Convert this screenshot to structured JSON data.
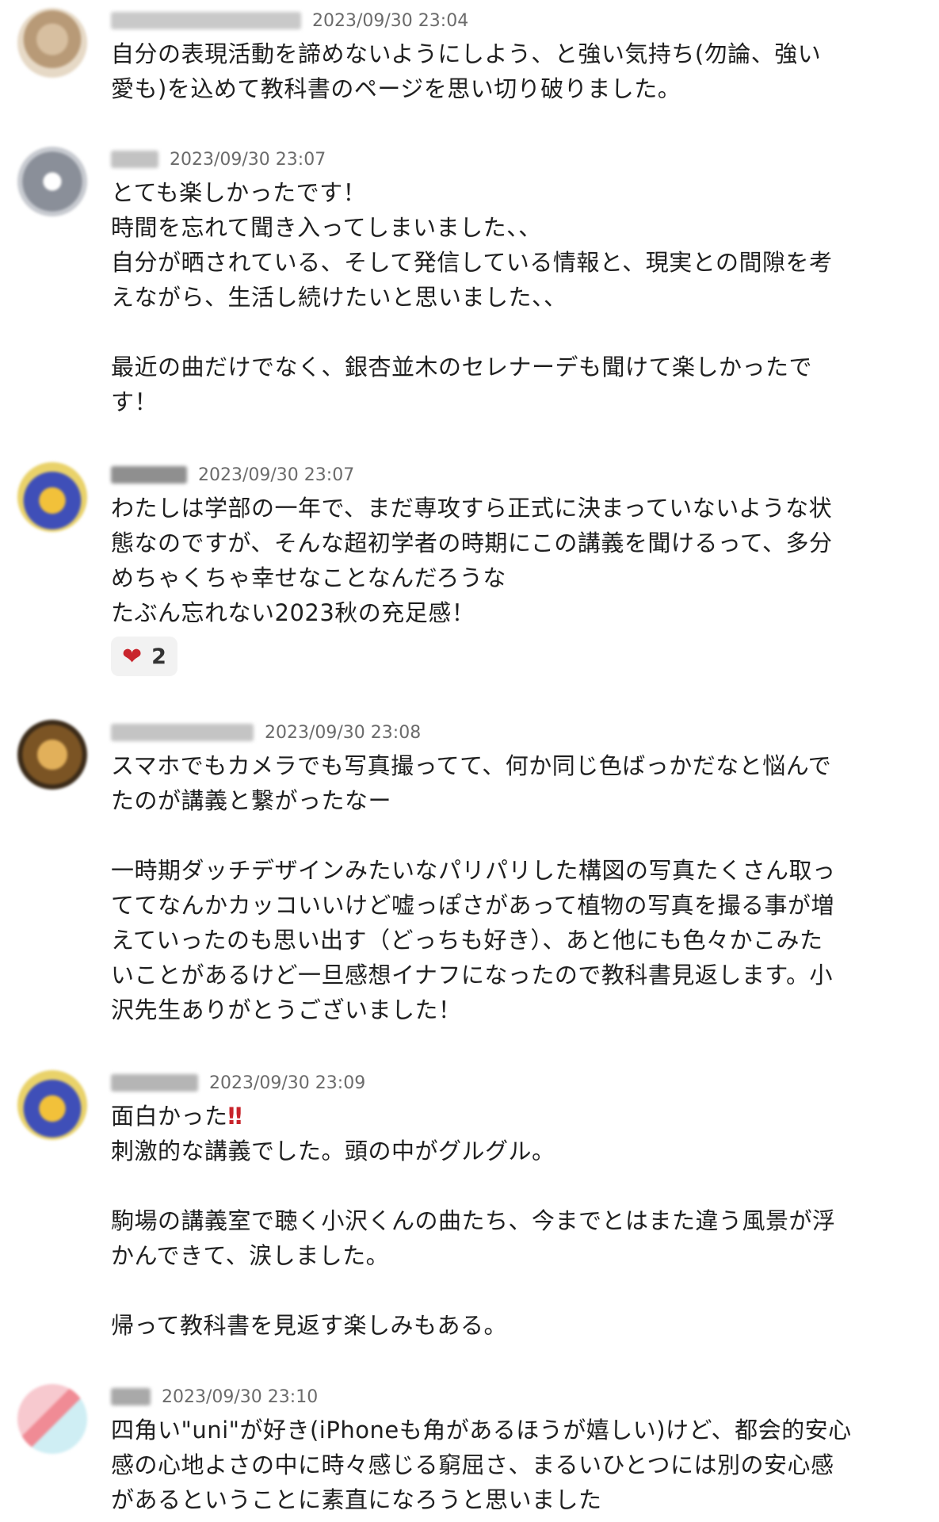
{
  "comments": [
    {
      "timestamp": "2023/09/30 23:04",
      "lines": [
        "自分の表現活動を諦めないようにしよう、と強い気持ち(勿論、強い",
        "愛も)を込めて教科書のページを思い切り破りました。"
      ]
    },
    {
      "timestamp": "2023/09/30 23:07",
      "lines": [
        "とても楽しかったです！",
        "時間を忘れて聞き入ってしまいました、、",
        "自分が晒されている、そして発信している情報と、現実との間隙を考",
        "えながら、生活し続けたいと思いました、、",
        "",
        "最近の曲だけでなく、銀杏並木のセレナーデも聞けて楽しかったで",
        "す！"
      ]
    },
    {
      "timestamp": "2023/09/30 23:07",
      "lines": [
        "わたしは学部の一年で、まだ専攻すら正式に決まっていないような状",
        "態なのですが、そんな超初学者の時期にこの講義を聞けるって、多分",
        "めちゃくちゃ幸せなことなんだろうな",
        "たぶん忘れない2023秋の充足感！"
      ],
      "reaction": {
        "icon": "heart-icon",
        "count": "2"
      }
    },
    {
      "timestamp": "2023/09/30 23:08",
      "lines": [
        "スマホでもカメラでも写真撮ってて、何か同じ色ばっかだなと悩んで",
        "たのが講義と繋がったなー",
        "",
        "一時期ダッチデザインみたいなパリパリした構図の写真たくさん取っ",
        "ててなんかカッコいいけど嘘っぽさがあって植物の写真を撮る事が増",
        "えていったのも思い出す（どっちも好き）、あと他にも色々かこみた",
        "いことがあるけど一旦感想イナフになったので教科書見返します。小",
        "沢先生ありがとうございました！"
      ]
    },
    {
      "timestamp": "2023/09/30 23:09",
      "lines": [
        "面白かった",
        "刺激的な講義でした。頭の中がグルグル。",
        "",
        "駒場の講義室で聴く小沢くんの曲たち、今までとはまた違う風景が浮",
        "かんできて、涙しました。",
        "",
        "帰って教科書を見返す楽しみもある。"
      ],
      "emoji_after_first_line": "‼"
    },
    {
      "timestamp": "2023/09/30 23:10",
      "lines": [
        "四角い\"uni\"が好き(iPhoneも角があるほうが嬉しい)けど、都会的安心",
        "感の心地よさの中に時々感じる窮屈さ、まるいひとつには別の安心感",
        "があるということに素直になろうと思いました"
      ]
    }
  ],
  "colors": {
    "timestamp": "#6b6b6b",
    "text": "#1f1f1f",
    "heart": "#c9252d",
    "reaction_bg": "#f2f2f2"
  }
}
